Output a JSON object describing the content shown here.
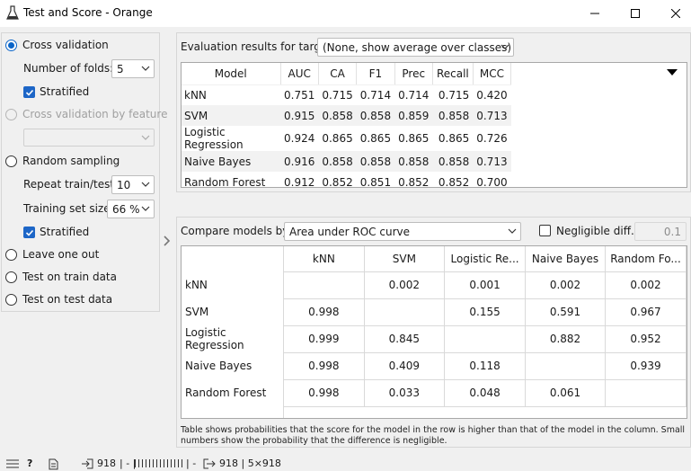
{
  "window": {
    "title": "Test and Score - Orange"
  },
  "sampling": {
    "cross_validation": {
      "label": "Cross validation",
      "selected": true
    },
    "folds": {
      "label": "Number of folds:",
      "value": "5"
    },
    "stratified_cv": {
      "label": "Stratified",
      "checked": true
    },
    "cv_by_feature": {
      "label": "Cross validation by feature",
      "disabled": true,
      "value": ""
    },
    "random_sampling": {
      "label": "Random sampling",
      "selected": false
    },
    "repeat": {
      "label": "Repeat train/test:",
      "value": "10"
    },
    "train_size": {
      "label": "Training set size:",
      "value": "66 %"
    },
    "stratified_rs": {
      "label": "Stratified",
      "checked": true
    },
    "leave_one_out": {
      "label": "Leave one out"
    },
    "train_data": {
      "label": "Test on train data"
    },
    "test_data": {
      "label": "Test on test data"
    }
  },
  "evaluation": {
    "target_label": "Evaluation results for target",
    "target_value": "(None, show average over classes)",
    "columns": [
      "Model",
      "AUC",
      "CA",
      "F1",
      "Prec",
      "Recall",
      "MCC"
    ],
    "rows": [
      [
        "kNN",
        "0.751",
        "0.715",
        "0.714",
        "0.714",
        "0.715",
        "0.420"
      ],
      [
        "SVM",
        "0.915",
        "0.858",
        "0.858",
        "0.859",
        "0.858",
        "0.713"
      ],
      [
        "Logistic Regression",
        "0.924",
        "0.865",
        "0.865",
        "0.865",
        "0.865",
        "0.726"
      ],
      [
        "Naive Bayes",
        "0.916",
        "0.858",
        "0.858",
        "0.858",
        "0.858",
        "0.713"
      ],
      [
        "Random Forest",
        "0.912",
        "0.852",
        "0.851",
        "0.852",
        "0.852",
        "0.700"
      ]
    ]
  },
  "compare": {
    "label": "Compare models by:",
    "value": "Area under ROC curve",
    "negligible_label": "Negligible diff.:",
    "negligible_value": "0.1",
    "columns": [
      "kNN",
      "SVM",
      "Logistic Re...",
      "Naive Bayes",
      "Random Fo..."
    ],
    "rows": [
      {
        "name": "kNN",
        "values": [
          "",
          "0.002",
          "0.001",
          "0.002",
          "0.002"
        ]
      },
      {
        "name": "SVM",
        "values": [
          "0.998",
          "",
          "0.155",
          "0.591",
          "0.967"
        ]
      },
      {
        "name": "Logistic Regression",
        "values": [
          "0.999",
          "0.845",
          "",
          "0.882",
          "0.952"
        ]
      },
      {
        "name": "Naive Bayes",
        "values": [
          "0.998",
          "0.409",
          "0.118",
          "",
          "0.939"
        ]
      },
      {
        "name": "Random Forest",
        "values": [
          "0.998",
          "0.033",
          "0.048",
          "0.061",
          ""
        ]
      }
    ],
    "footnote": "Table shows probabilities that the score for the model in the row is higher than that of the model in the column. Small numbers show the probability that the difference is negligible."
  },
  "statusbar": {
    "input_count": "918",
    "middle": "| - |",
    "sep": "| -",
    "output_summary": "918 | 5×918"
  },
  "colors": {
    "accent": "#1d66c7",
    "row_alt": "#f2f2f2"
  }
}
